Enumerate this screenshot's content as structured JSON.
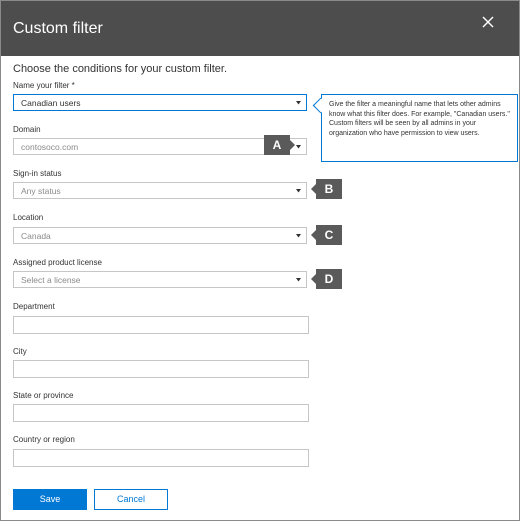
{
  "dialog": {
    "title": "Custom filter",
    "close_icon": "close-icon",
    "intro": "Choose the conditions for your custom filter."
  },
  "fields": {
    "name": {
      "label": "Name your filter *",
      "value": "Canadian users"
    },
    "domain": {
      "label": "Domain",
      "value": "contosoco.com"
    },
    "signin": {
      "label": "Sign-in status",
      "value": "Any status"
    },
    "location": {
      "label": "Location",
      "value": "Canada"
    },
    "license": {
      "label": "Assigned product license",
      "value": "Select a license"
    },
    "department": {
      "label": "Department",
      "value": ""
    },
    "city": {
      "label": "City",
      "value": ""
    },
    "state": {
      "label": "State or province",
      "value": ""
    },
    "country": {
      "label": "Country or region",
      "value": ""
    }
  },
  "callouts": {
    "a": "A",
    "b": "B",
    "c": "C",
    "d": "D"
  },
  "tooltip": {
    "text": "Give the filter a meaningful name that lets other admins know what this filter does. For example, \"Canadian users.\" Custom filters will be seen by all admins in your organization who have permission to view users."
  },
  "buttons": {
    "save": "Save",
    "cancel": "Cancel"
  },
  "colors": {
    "header": "#4d4d4d",
    "accent": "#0078d4",
    "callout": "#5a5a5a"
  }
}
